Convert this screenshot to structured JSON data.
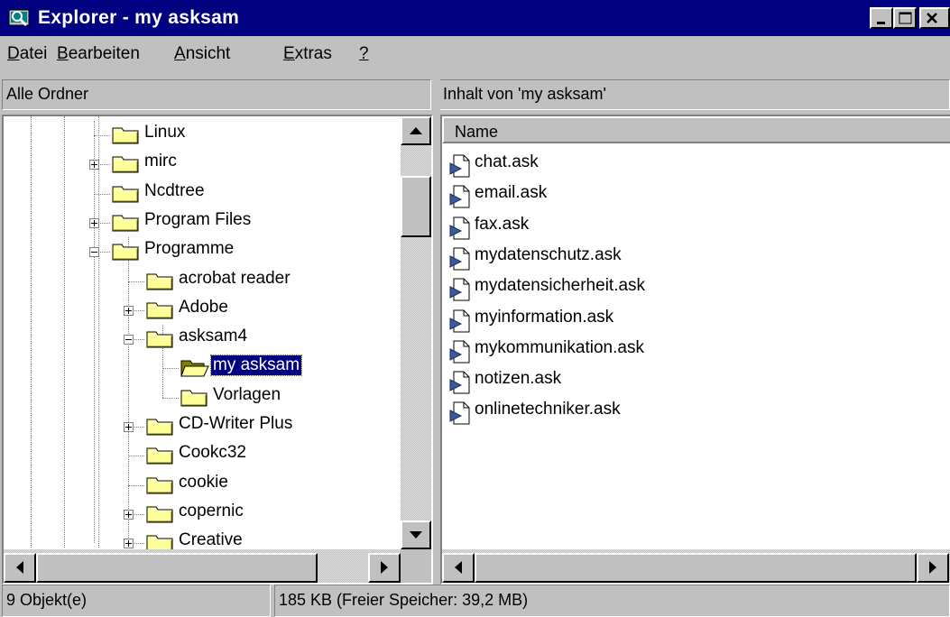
{
  "window": {
    "title": "Explorer - my asksam",
    "controls": [
      "minimize-icon",
      "maximize-icon",
      "close-icon"
    ],
    "title_bar_color": "#000080"
  },
  "menu": [
    {
      "key": "D",
      "rest": "atei"
    },
    {
      "key": "B",
      "rest": "earbeiten"
    },
    {
      "key": "A",
      "rest": "nsicht"
    },
    {
      "key": "E",
      "rest": "xtras"
    },
    {
      "key": "?",
      "rest": ""
    }
  ],
  "left_pane": {
    "header": "Alle Ordner",
    "tree": [
      {
        "label": "Linux",
        "expander": null
      },
      {
        "label": "mirc",
        "expander": "plus"
      },
      {
        "label": "Ncdtree",
        "expander": null
      },
      {
        "label": "Program Files",
        "expander": "plus"
      },
      {
        "label": "Programme",
        "expander": "minus"
      },
      {
        "label": "acrobat reader",
        "expander": null
      },
      {
        "label": "Adobe",
        "expander": "plus"
      },
      {
        "label": "asksam4",
        "expander": "minus"
      },
      {
        "label": "my asksam",
        "expander": null,
        "selected": true,
        "open": true
      },
      {
        "label": "Vorlagen",
        "expander": null
      },
      {
        "label": "CD-Writer Plus",
        "expander": "plus"
      },
      {
        "label": "Cookc32",
        "expander": null
      },
      {
        "label": "cookie",
        "expander": null
      },
      {
        "label": "copernic",
        "expander": "plus"
      },
      {
        "label": "Creative",
        "expander": "plus"
      }
    ],
    "icons": {
      "folder": "folder-icon",
      "open_folder": "open-folder-icon"
    }
  },
  "right_pane": {
    "header": "Inhalt von 'my asksam'",
    "column_header": "Name",
    "files": [
      "chat.ask",
      "email.ask",
      "fax.ask",
      "mydatenschutz.ask",
      "mydatensicherheit.ask",
      "myinformation.ask",
      "mykommunikation.ask",
      "notizen.ask",
      "onlinetechniker.ask"
    ],
    "file_icon": "asksam-document-icon"
  },
  "status_bar": {
    "objects": "9 Objekt(e)",
    "size": "185 KB (Freier Speicher: 39,2 MB)"
  },
  "colors": {
    "selection": "#000080",
    "face": "#c0c0c0",
    "folder": "#ffff99"
  }
}
